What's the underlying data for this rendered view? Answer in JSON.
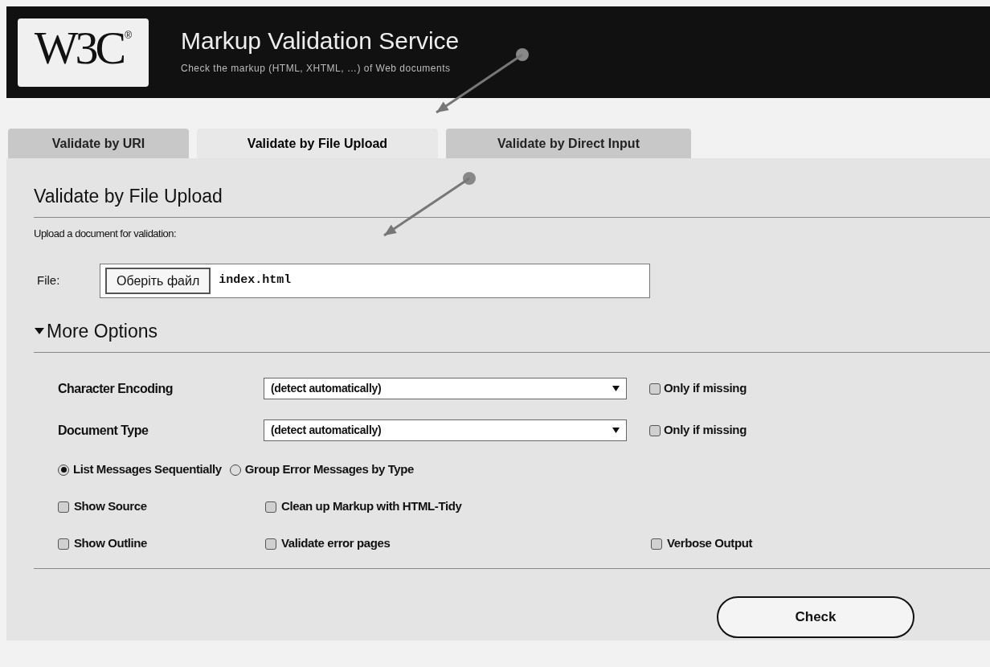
{
  "header": {
    "logo": "W3C",
    "logo_mark": "®",
    "title": "Markup Validation Service",
    "subtitle": "Check the markup (HTML, XHTML, …) of Web documents"
  },
  "tabs": [
    {
      "label": "Validate by URI",
      "selected": false
    },
    {
      "label": "Validate by File Upload",
      "selected": true
    },
    {
      "label": "Validate by Direct Input",
      "selected": false
    }
  ],
  "section": {
    "heading": "Validate by File Upload",
    "instruction": "Upload a document for validation:",
    "file_label": "File:",
    "file_button": "Оберіть файл",
    "file_name": "index.html"
  },
  "more_options": {
    "label": "More Options",
    "expanded": true,
    "selects": [
      {
        "label": "Character Encoding",
        "value": "(detect automatically)",
        "option": {
          "label": "Only if missing",
          "checked": false
        }
      },
      {
        "label": "Document Type",
        "value": "(detect automatically)",
        "option": {
          "label": "Only if missing",
          "checked": false
        }
      }
    ],
    "radios": [
      {
        "label": "List Messages Sequentially",
        "selected": true
      },
      {
        "label": "Group Error Messages by Type",
        "selected": false
      }
    ],
    "checkbox_rows": [
      [
        {
          "label": "Show Source",
          "checked": false
        },
        {
          "label": "Clean up Markup with HTML-Tidy",
          "checked": false
        }
      ],
      [
        {
          "label": "Show Outline",
          "checked": false
        },
        {
          "label": "Validate error pages",
          "checked": false
        },
        {
          "label": "Verbose Output",
          "checked": false
        }
      ]
    ]
  },
  "submit": "Check"
}
